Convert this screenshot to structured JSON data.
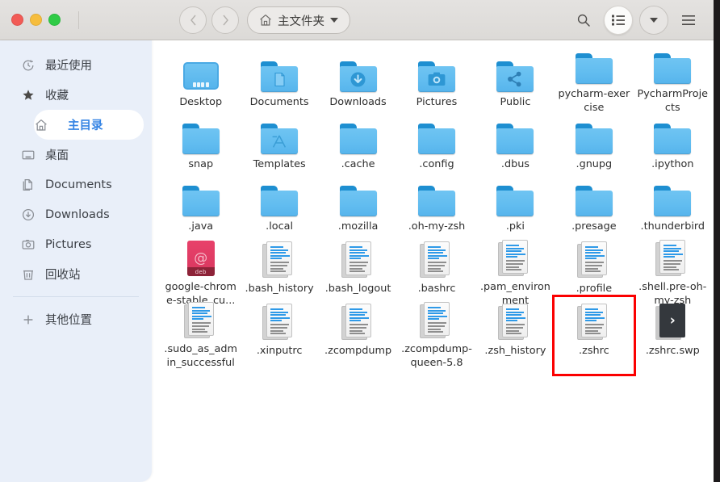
{
  "window": {
    "controls": [
      "close",
      "minimize",
      "maximize"
    ]
  },
  "header": {
    "back_icon": "chevron-left-icon",
    "forward_icon": "chevron-right-icon",
    "home_icon": "home-icon",
    "path_label": "主文件夹",
    "path_dropdown_icon": "chevron-down-icon",
    "search_icon": "search-icon",
    "view_list_icon": "list-view-icon",
    "view_dropdown_icon": "chevron-down-icon",
    "menu_icon": "hamburger-menu-icon"
  },
  "sidebar": {
    "items": [
      {
        "label": "最近使用",
        "icon": "recent-clock-icon",
        "active": false
      },
      {
        "label": "收藏",
        "icon": "star-icon",
        "active": false
      },
      {
        "label": "主目录",
        "icon": "home-icon",
        "active": true
      },
      {
        "label": "桌面",
        "icon": "desktop-icon",
        "active": false
      },
      {
        "label": "Documents",
        "icon": "documents-icon",
        "active": false
      },
      {
        "label": "Downloads",
        "icon": "downloads-icon",
        "active": false
      },
      {
        "label": "Pictures",
        "icon": "pictures-icon",
        "active": false
      },
      {
        "label": "回收站",
        "icon": "trash-icon",
        "active": false
      }
    ],
    "other_locations": {
      "label": "其他位置",
      "icon": "plus-icon"
    }
  },
  "files": [
    {
      "name": "Desktop",
      "type": "monitor",
      "emblem": ""
    },
    {
      "name": "Documents",
      "type": "folder",
      "emblem": "document"
    },
    {
      "name": "Downloads",
      "type": "folder",
      "emblem": "download"
    },
    {
      "name": "Pictures",
      "type": "folder",
      "emblem": "camera"
    },
    {
      "name": "Public",
      "type": "folder",
      "emblem": "share"
    },
    {
      "name": "pycharm-exercise",
      "type": "folder",
      "emblem": ""
    },
    {
      "name": "PycharmProjects",
      "type": "folder",
      "emblem": ""
    },
    {
      "name": "snap",
      "type": "folder",
      "emblem": ""
    },
    {
      "name": "Templates",
      "type": "folder",
      "emblem": "template"
    },
    {
      "name": ".cache",
      "type": "folder",
      "emblem": ""
    },
    {
      "name": ".config",
      "type": "folder",
      "emblem": ""
    },
    {
      "name": ".dbus",
      "type": "folder",
      "emblem": ""
    },
    {
      "name": ".gnupg",
      "type": "folder",
      "emblem": ""
    },
    {
      "name": ".ipython",
      "type": "folder",
      "emblem": ""
    },
    {
      "name": ".java",
      "type": "folder",
      "emblem": ""
    },
    {
      "name": ".local",
      "type": "folder",
      "emblem": ""
    },
    {
      "name": ".mozilla",
      "type": "folder",
      "emblem": ""
    },
    {
      "name": ".oh-my-zsh",
      "type": "folder",
      "emblem": ""
    },
    {
      "name": ".pki",
      "type": "folder",
      "emblem": ""
    },
    {
      "name": ".presage",
      "type": "folder",
      "emblem": ""
    },
    {
      "name": ".thunderbird",
      "type": "folder",
      "emblem": ""
    },
    {
      "name": "google-chrome-stable_cu...",
      "type": "deb",
      "emblem": "deb"
    },
    {
      "name": ".bash_history",
      "type": "doc",
      "emblem": ""
    },
    {
      "name": ".bash_logout",
      "type": "doc",
      "emblem": ""
    },
    {
      "name": ".bashrc",
      "type": "doc",
      "emblem": ""
    },
    {
      "name": ".pam_environment",
      "type": "doc",
      "emblem": ""
    },
    {
      "name": ".profile",
      "type": "doc",
      "emblem": ""
    },
    {
      "name": ".shell.pre-oh-my-zsh",
      "type": "doc",
      "emblem": ""
    },
    {
      "name": ".sudo_as_admin_successful",
      "type": "doc",
      "emblem": ""
    },
    {
      "name": ".xinputrc",
      "type": "doc",
      "emblem": ""
    },
    {
      "name": ".zcompdump",
      "type": "doc",
      "emblem": ""
    },
    {
      "name": ".zcompdump-queen-5.8",
      "type": "doc",
      "emblem": ""
    },
    {
      "name": ".zsh_history",
      "type": "doc",
      "emblem": ""
    },
    {
      "name": ".zshrc",
      "type": "doc",
      "emblem": "",
      "selected": true
    },
    {
      "name": ".zshrc.swp",
      "type": "swp",
      "emblem": ""
    }
  ],
  "deb_tag": "deb",
  "colors": {
    "accent": "#3584e4",
    "sidebar_bg": "#e9eff9",
    "folder_blue": "#62bdf0",
    "folder_tab": "#1e8fd1",
    "selection_outline": "#fb0000",
    "deb_red": "#d8375f",
    "swp_dark": "#34383d"
  }
}
